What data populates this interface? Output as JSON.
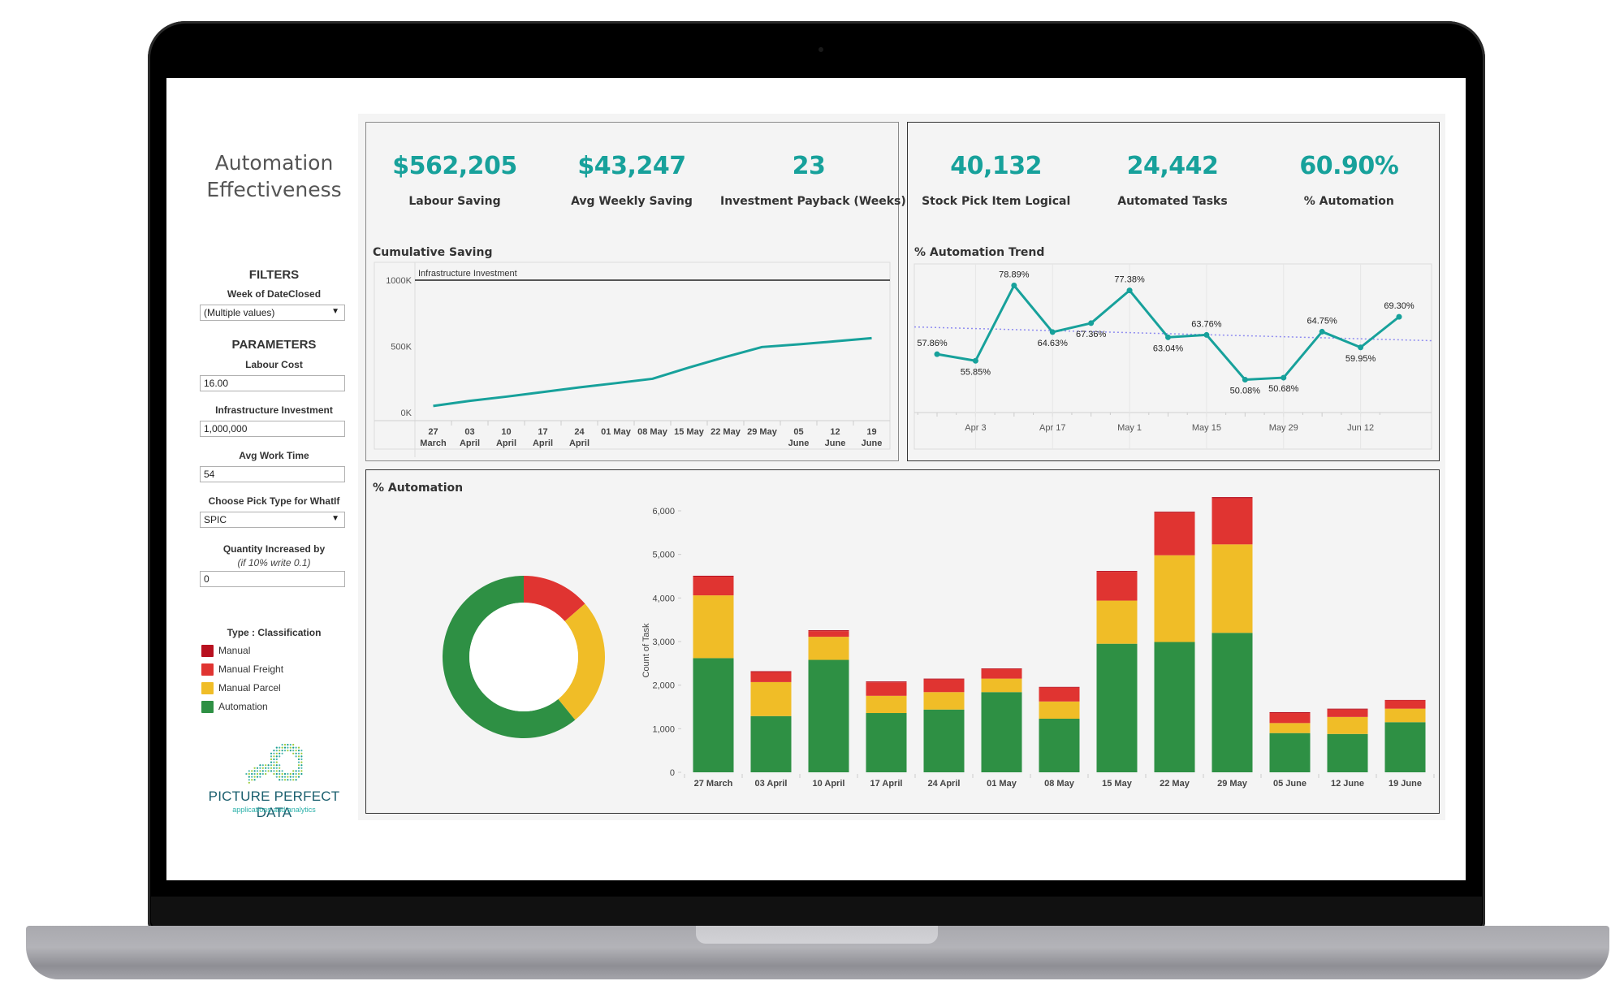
{
  "sidebar": {
    "title_line1": "Automation",
    "title_line2": "Effectiveness",
    "filters_heading": "FILTERS",
    "week_filter_label": "Week of DateClosed",
    "week_filter_value": "(Multiple values)",
    "parameters_heading": "PARAMETERS",
    "labour_cost_label": "Labour Cost",
    "labour_cost_value": "16.00",
    "infra_label": "Infrastructure Investment",
    "infra_value": "1,000,000",
    "avg_work_label": "Avg Work Time",
    "avg_work_value": "54",
    "pick_type_label": "Choose Pick Type for WhatIf",
    "pick_type_value": "SPIC",
    "qty_label": "Quantity Increased by",
    "qty_hint": "(if 10% write 0.1)",
    "qty_value": "0",
    "legend_title": "Type : Classification",
    "legend": [
      {
        "label": "Manual",
        "color": "#b8101f"
      },
      {
        "label": "Manual Freight",
        "color": "#e03431"
      },
      {
        "label": "Manual Parcel",
        "color": "#f0bd27"
      },
      {
        "label": "Automation",
        "color": "#2e9044"
      }
    ],
    "logo_name": "PICTURE PERFECT DATA",
    "logo_sub": "applications and analytics"
  },
  "kpis_left": [
    {
      "value": "$562,205",
      "label": "Labour Saving"
    },
    {
      "value": "$43,247",
      "label": "Avg Weekly Saving"
    },
    {
      "value": "23",
      "label": "Investment Payback (Weeks)"
    }
  ],
  "kpis_right": [
    {
      "value": "40,132",
      "label": "Stock Pick Item Logical"
    },
    {
      "value": "24,442",
      "label": "Automated Tasks"
    },
    {
      "value": "60.90%",
      "label": "% Automation"
    }
  ],
  "colors": {
    "accent": "#17a19b",
    "manual": "#b8101f",
    "manual_freight": "#e03431",
    "manual_parcel": "#f0bd27",
    "automation": "#2e9044",
    "trend_line": "#8f8cf0"
  },
  "chart_data": [
    {
      "id": "cumulative_saving",
      "type": "line",
      "title": "Cumulative Saving",
      "categories": [
        [
          "27",
          "March"
        ],
        [
          "03",
          "April"
        ],
        [
          "10",
          "April"
        ],
        [
          "17",
          "April"
        ],
        [
          "24",
          "April"
        ],
        [
          "01 May"
        ],
        [
          "08 May"
        ],
        [
          "15 May"
        ],
        [
          "22 May"
        ],
        [
          "29 May"
        ],
        [
          "05",
          "June"
        ],
        [
          "12",
          "June"
        ],
        [
          "19",
          "June"
        ]
      ],
      "values": [
        50000,
        88000,
        120000,
        155000,
        190000,
        222000,
        255000,
        340000,
        420000,
        495000,
        515000,
        538000,
        562205
      ],
      "reference_line": {
        "label": "Infrastructure Investment",
        "value": 1000000
      },
      "ylim": [
        0,
        1000000
      ],
      "yticks": [
        {
          "v": 0,
          "label": "0K"
        },
        {
          "v": 500000,
          "label": "500K"
        },
        {
          "v": 1000000,
          "label": "1000K"
        }
      ],
      "xlabel": "",
      "ylabel": ""
    },
    {
      "id": "automation_trend",
      "type": "line",
      "title": "% Automation Trend",
      "values": [
        57.86,
        55.85,
        78.89,
        64.63,
        67.36,
        77.38,
        63.04,
        63.76,
        50.08,
        50.68,
        64.75,
        59.95,
        69.3
      ],
      "labels": [
        "57.86%",
        "55.85%",
        "78.89%",
        "64.63%",
        "67.36%",
        "77.38%",
        "63.04%",
        "63.76%",
        "50.08%",
        "50.68%",
        "64.75%",
        "59.95%",
        "69.30%"
      ],
      "label_pos": [
        "above-left",
        "below",
        "above",
        "below",
        "below",
        "above",
        "below",
        "above",
        "below",
        "below",
        "above",
        "below",
        "above"
      ],
      "xticks": [
        {
          "i": 1,
          "label": "Apr 3"
        },
        {
          "i": 3,
          "label": "Apr 17"
        },
        {
          "i": 5,
          "label": "May 1"
        },
        {
          "i": 7,
          "label": "May 15"
        },
        {
          "i": 9,
          "label": "May 29"
        },
        {
          "i": 11,
          "label": "Jun 12"
        }
      ],
      "trend": {
        "start": 66.2,
        "end": 62.0
      },
      "ylim": [
        42,
        82
      ]
    },
    {
      "id": "automation_donut",
      "type": "pie",
      "title": "% Automation",
      "slices": [
        {
          "name": "Manual Freight",
          "value": 13.6
        },
        {
          "name": "Manual Parcel",
          "value": 25.5
        },
        {
          "name": "Automation",
          "value": 60.9
        }
      ]
    },
    {
      "id": "count_of_task",
      "type": "bar",
      "stacked": true,
      "ylabel": "Count of Task",
      "ylim": [
        0,
        6500
      ],
      "yticks": [
        0,
        1000,
        2000,
        3000,
        4000,
        5000,
        6000
      ],
      "categories": [
        "27 March",
        "03 April",
        "10 April",
        "17 April",
        "24 April",
        "01 May",
        "08 May",
        "15 May",
        "22 May",
        "29 May",
        "05 June",
        "12 June",
        "19 June"
      ],
      "series": [
        {
          "name": "Automation",
          "values": [
            2620,
            1290,
            2580,
            1360,
            1440,
            1840,
            1230,
            2950,
            2990,
            3200,
            900,
            880,
            1150
          ]
        },
        {
          "name": "Manual Parcel",
          "values": [
            1440,
            780,
            530,
            395,
            400,
            310,
            395,
            990,
            1990,
            2030,
            230,
            390,
            310
          ]
        },
        {
          "name": "Manual Freight",
          "values": [
            430,
            230,
            130,
            310,
            290,
            220,
            320,
            660,
            980,
            1060,
            230,
            170,
            190
          ]
        },
        {
          "name": "Manual",
          "values": [
            20,
            20,
            20,
            20,
            20,
            15,
            15,
            20,
            20,
            25,
            20,
            20,
            10
          ]
        }
      ]
    }
  ]
}
